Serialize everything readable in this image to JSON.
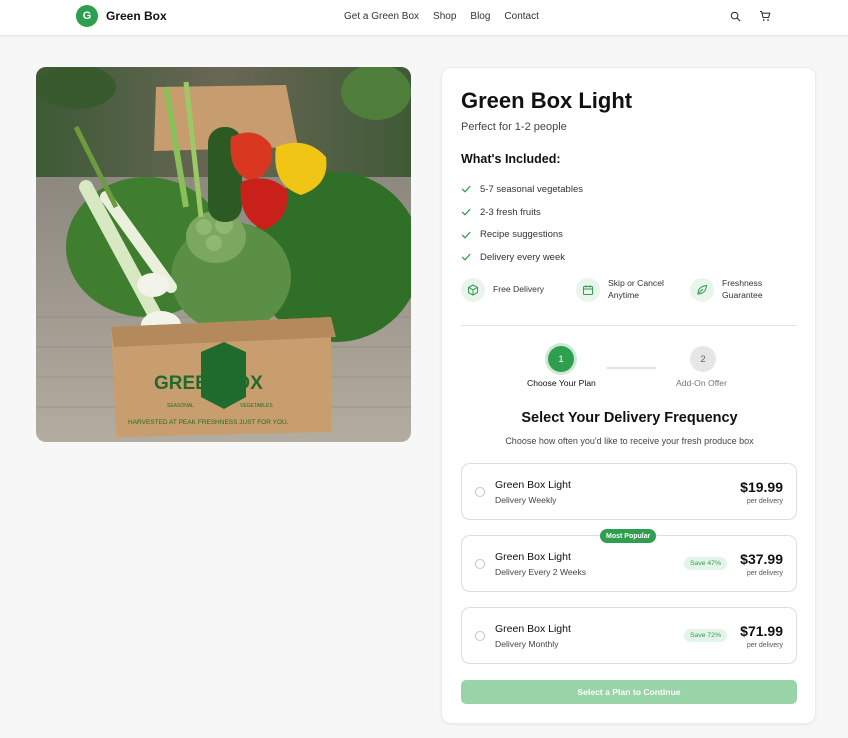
{
  "header": {
    "logo_letter": "G",
    "brand": "Green Box",
    "nav": [
      "Get a Green Box",
      "Shop",
      "Blog",
      "Contact"
    ],
    "icons": [
      "search-icon",
      "cart-icon"
    ]
  },
  "product": {
    "box_logo": "GREENBOX",
    "box_small_left": "SEASONAL",
    "box_small_right": "VEGETABLES",
    "box_tagline": "HARVESTED AT PEAK FRESHNESS JUST FOR YOU."
  },
  "card": {
    "title": "Green Box Light",
    "subtitle": "Perfect for 1-2 people",
    "included_title": "What's Included:",
    "included": [
      "5-7 seasonal vegetables",
      "2-3 fresh fruits",
      "Recipe suggestions",
      "Delivery every week"
    ],
    "features": [
      {
        "icon": "box-icon",
        "line1": "Free Delivery",
        "line2": ""
      },
      {
        "icon": "calendar-icon",
        "line1": "Skip or Cancel",
        "line2": "Anytime"
      },
      {
        "icon": "leaf-icon",
        "line1": "Freshness",
        "line2": "Guarantee"
      }
    ],
    "steps": [
      {
        "number": "1",
        "label": "Choose Your Plan",
        "active": true
      },
      {
        "number": "2",
        "label": "Add-On Offer",
        "active": false
      }
    ],
    "frequency_title": "Select Your Delivery Frequency",
    "frequency_sub": "Choose how often you'd like to receive your fresh produce box",
    "options": [
      {
        "name": "Green Box Light",
        "frequency": "Delivery Weekly",
        "price": "$19.99",
        "per": "per delivery",
        "save": "",
        "badge": ""
      },
      {
        "name": "Green Box Light",
        "frequency": "Delivery Every 2 Weeks",
        "price": "$37.99",
        "per": "per delivery",
        "save": "Save 47%",
        "badge": "Most Popular"
      },
      {
        "name": "Green Box Light",
        "frequency": "Delivery Monthly",
        "price": "$71.99",
        "per": "per delivery",
        "save": "Save 72%",
        "badge": ""
      }
    ],
    "continue_label": "Select a Plan to Continue"
  },
  "colors": {
    "brand_green": "#2e9e4f",
    "light_green": "#e5f4e9",
    "disabled_button": "#99d4a8",
    "background": "#f7f7f7"
  }
}
